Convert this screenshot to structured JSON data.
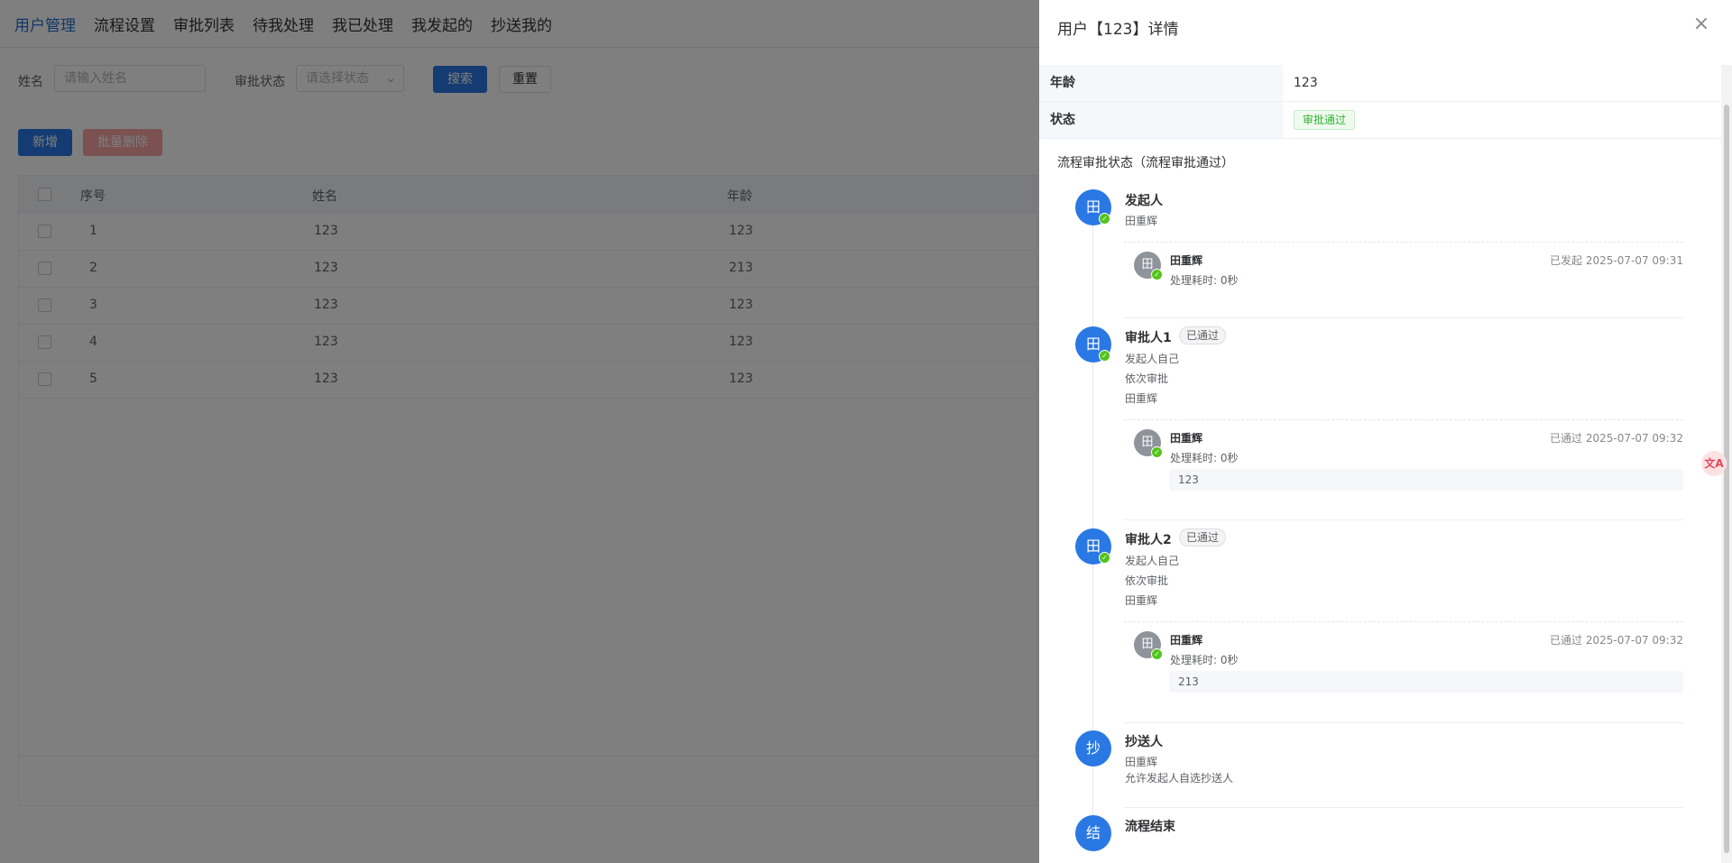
{
  "nav": {
    "items": [
      "用户管理",
      "流程设置",
      "审批列表",
      "待我处理",
      "我已处理",
      "我发起的",
      "抄送我的"
    ]
  },
  "filters": {
    "name_label": "姓名",
    "name_placeholder": "请输入姓名",
    "status_label": "审批状态",
    "status_placeholder": "请选择状态",
    "search_label": "搜索",
    "reset_label": "重置"
  },
  "actions": {
    "add_label": "新增",
    "batch_delete_label": "批量删除"
  },
  "table": {
    "headers": [
      "序号",
      "姓名",
      "年龄"
    ],
    "rows": [
      [
        "1",
        "123",
        "123"
      ],
      [
        "2",
        "123",
        "213"
      ],
      [
        "3",
        "123",
        "123"
      ],
      [
        "4",
        "123",
        "123"
      ],
      [
        "5",
        "123",
        "123"
      ]
    ]
  },
  "drawer": {
    "title": "用户【123】详情",
    "close_symbol": "×",
    "details": [
      {
        "label": "年龄",
        "value": "123"
      },
      {
        "label": "状态",
        "value": "审批通过"
      }
    ],
    "process_title": "流程审批状态（流程审批通过）",
    "nodes": {
      "initiator": {
        "avatar": "田",
        "title": "发起人",
        "sub": [
          "田重辉"
        ],
        "activity": {
          "avatar": "田",
          "name": "田重辉",
          "time": "已发起 2025-07-07 09:31",
          "duration": "处理耗时: 0秒"
        }
      },
      "approver1": {
        "avatar": "田",
        "title": "审批人1",
        "tag": "已通过",
        "sub": [
          "发起人自己",
          "依次审批",
          "田重辉"
        ],
        "activity": {
          "avatar": "田",
          "name": "田重辉",
          "time": "已通过 2025-07-07 09:32",
          "duration": "处理耗时: 0秒",
          "comment": "123"
        }
      },
      "approver2": {
        "avatar": "田",
        "title": "审批人2",
        "tag": "已通过",
        "sub": [
          "发起人自己",
          "依次审批",
          "田重辉"
        ],
        "activity": {
          "avatar": "田",
          "name": "田重辉",
          "time": "已通过 2025-07-07 09:32",
          "duration": "处理耗时: 0秒",
          "comment": "213"
        }
      },
      "cc": {
        "avatar": "抄",
        "title": "抄送人",
        "sub": [
          "田重辉",
          "允许发起人自选抄送人"
        ]
      },
      "end": {
        "avatar": "结",
        "title": "流程结束"
      }
    }
  },
  "float_tool": {
    "label": "文A"
  },
  "colors": {
    "primary": "#2a78e4",
    "success": "#52c41a",
    "overlay": "rgba(0,0,0,0.5)"
  }
}
